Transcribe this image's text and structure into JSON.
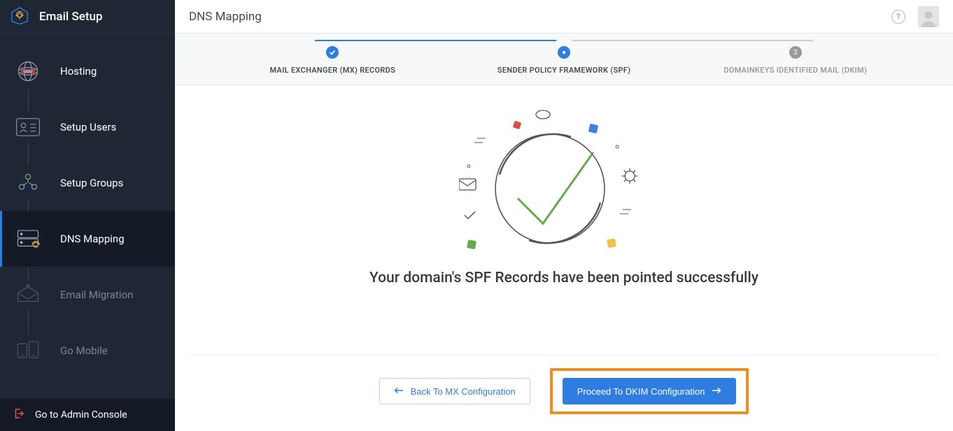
{
  "sidebar": {
    "title": "Email Setup",
    "items": [
      {
        "label": "Hosting"
      },
      {
        "label": "Setup Users"
      },
      {
        "label": "Setup Groups"
      },
      {
        "label": "DNS Mapping"
      },
      {
        "label": "Email Migration"
      },
      {
        "label": "Go Mobile"
      }
    ],
    "footer_label": "Go to Admin Console"
  },
  "header": {
    "title": "DNS Mapping"
  },
  "steps": {
    "s1": "MAIL EXCHANGER (MX) RECORDS",
    "s2": "SENDER POLICY FRAMEWORK (SPF)",
    "s3": "DOMAINKEYS IDENTIFIED MAIL (DKIM)",
    "s3_num": "3"
  },
  "content": {
    "success_msg": "Your domain's SPF Records have been pointed successfully",
    "back_btn": "Back To MX Configuration",
    "next_btn": "Proceed To DKIM Configuration"
  },
  "colors": {
    "accent": "#2f7de1",
    "highlight": "#f28c1a"
  }
}
